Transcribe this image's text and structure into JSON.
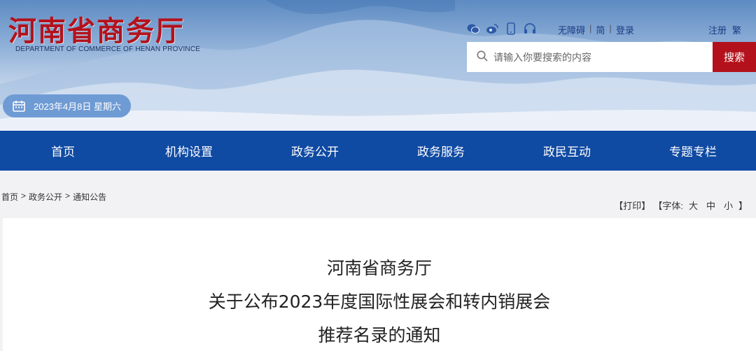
{
  "header": {
    "title": "河南省商务厅",
    "subtitle": "DEPARTMENT OF COMMERCE OF HENAN PROVINCE",
    "date": "2023年4月8日 星期六",
    "social_icons": [
      "wechat-icon",
      "weibo-icon",
      "mobile-icon",
      "headset-icon"
    ],
    "links": {
      "accessible": "无障碍",
      "simplified": "简",
      "login": "登录",
      "register": "注册",
      "traditional": "繁",
      "sep": "|"
    },
    "search": {
      "placeholder": "请输入你要搜索的内容",
      "button": "搜索"
    },
    "colors": {
      "brand_red": "#b3121c",
      "nav_blue": "#0f4aa3",
      "date_pill": "#6f9bd4"
    }
  },
  "nav": {
    "items": [
      "首页",
      "机构设置",
      "政务公开",
      "政务服务",
      "政民互动",
      "专题专栏"
    ]
  },
  "breadcrumb": {
    "home": "首页",
    "level1": "政务公开",
    "level2": "通知公告",
    "sep": ">"
  },
  "tools": {
    "print": "【打印】",
    "font_prefix": "【字体:",
    "large": "大",
    "medium": "中",
    "small": "小",
    "font_suffix": "】"
  },
  "article": {
    "title_lines": [
      "河南省商务厅",
      "关于公布2023年度国际性展会和转内销展会",
      "推荐名录的通知"
    ]
  }
}
